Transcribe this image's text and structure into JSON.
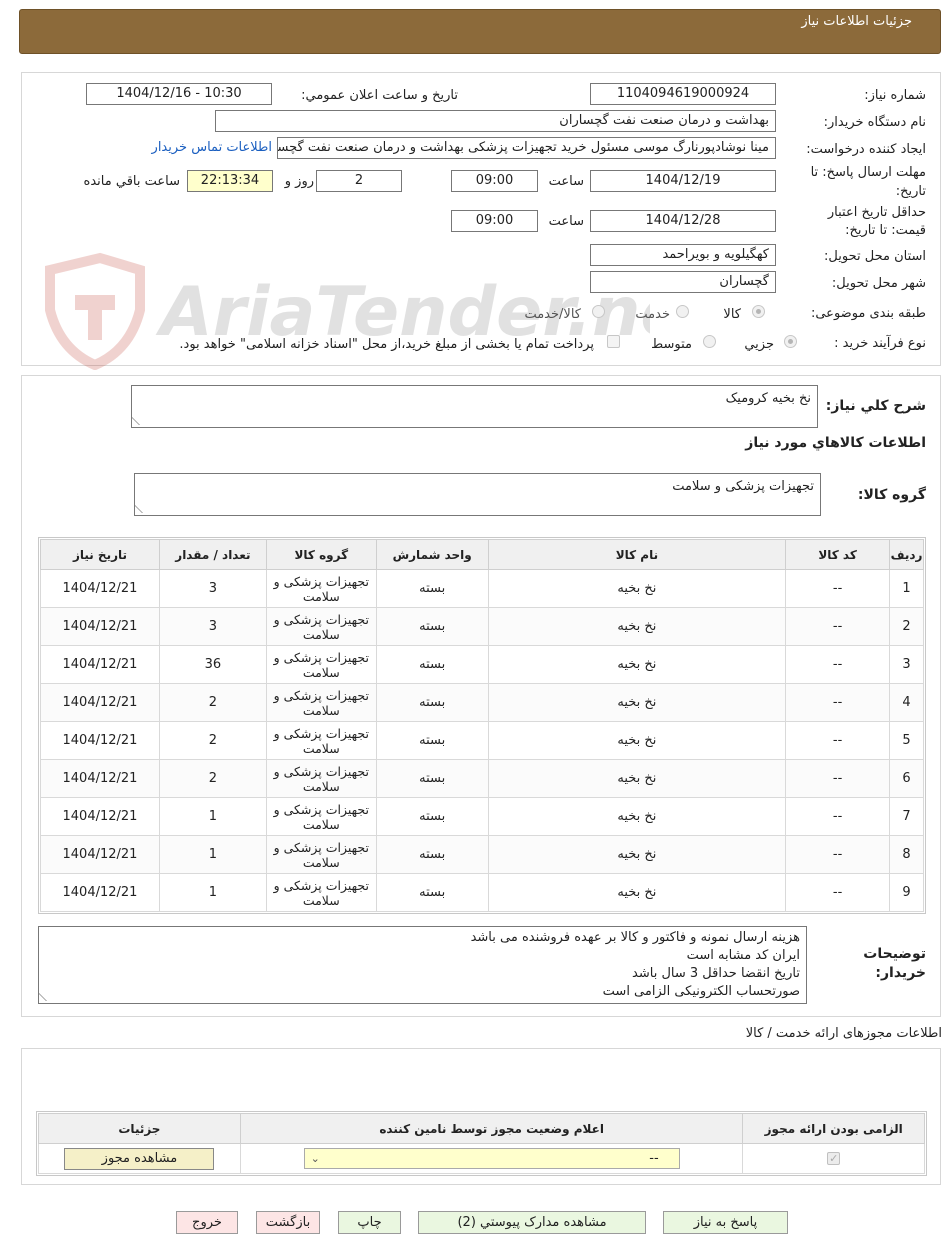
{
  "page": {
    "title": "جزئیات اطلاعات نیاز"
  },
  "form": {
    "need_number_label": "شماره نیاز:",
    "need_number": "1104094619000924",
    "announce_label": "تاریخ و ساعت اعلان عمومي:",
    "announce_value": "1404/12/16 - 10:30",
    "buyer_label": "نام دستگاه خریدار:",
    "buyer_value": "بهداشت و درمان صنعت نفت گچساران",
    "creator_label": "ایجاد کننده درخواست:",
    "creator_value": "مینا نوشادپورنارگ موسی مسئول خرید تجهیزات پزشکی  بهداشت و درمان صنعت نفت گچساران",
    "contact_link": "اطلاعات تماس خریدار",
    "deadline_label_1": "مهلت ارسال پاسخ: تا",
    "deadline_label_2": "تاریخ:",
    "deadline_date": "1404/12/19",
    "hour_label": "ساعت",
    "deadline_time": "09:00",
    "days_value": "2",
    "days_label": "روز و",
    "remaining_time": "22:13:34",
    "remaining_label": "ساعت باقي مانده",
    "validity_label_1": "حداقل تاریخ اعتبار",
    "validity_label_2": "قیمت: تا تاریخ:",
    "validity_date": "1404/12/28",
    "validity_time": "09:00",
    "province_label": "استان محل تحویل:",
    "province_value": "کهگیلویه و بویراحمد",
    "city_label": "شهر محل تحویل:",
    "city_value": "گچساران",
    "category_label": "طبقه بندی موضوعی:",
    "category_options": [
      "کالا",
      "خدمت",
      "کالا/خدمت"
    ],
    "process_label": "نوع فرآیند خرید :",
    "process_options": [
      "جزیي",
      "متوسط"
    ],
    "payment_note": "پرداخت تمام یا بخشی از مبلغ خرید،از محل \"اسناد خزانه اسلامی\" خواهد بود."
  },
  "description": {
    "label": "شرح کلي نیاز:",
    "value": "نخ بخیه کرومیک",
    "goods_info_title": "اطلاعات کالاهاي مورد نیاز",
    "group_label": "گروه کالا:",
    "group_value": "تجهیزات پزشکی و سلامت"
  },
  "items_table": {
    "headers": [
      "ردیف",
      "کد کالا",
      "نام کالا",
      "واحد شمارش",
      "گروه کالا",
      "تعداد / مقدار",
      "تاریخ نیاز"
    ],
    "rows": [
      {
        "row": "1",
        "code": "--",
        "name": "نخ بخیه",
        "unit": "بسته",
        "group": "تجهیزات پزشکی و سلامت",
        "qty": "3",
        "date": "1404/12/21"
      },
      {
        "row": "2",
        "code": "--",
        "name": "نخ بخیه",
        "unit": "بسته",
        "group": "تجهیزات پزشکی و سلامت",
        "qty": "3",
        "date": "1404/12/21"
      },
      {
        "row": "3",
        "code": "--",
        "name": "نخ بخیه",
        "unit": "بسته",
        "group": "تجهیزات پزشکی و سلامت",
        "qty": "36",
        "date": "1404/12/21"
      },
      {
        "row": "4",
        "code": "--",
        "name": "نخ بخیه",
        "unit": "بسته",
        "group": "تجهیزات پزشکی و سلامت",
        "qty": "2",
        "date": "1404/12/21"
      },
      {
        "row": "5",
        "code": "--",
        "name": "نخ بخیه",
        "unit": "بسته",
        "group": "تجهیزات پزشکی و سلامت",
        "qty": "2",
        "date": "1404/12/21"
      },
      {
        "row": "6",
        "code": "--",
        "name": "نخ بخیه",
        "unit": "بسته",
        "group": "تجهیزات پزشکی و سلامت",
        "qty": "2",
        "date": "1404/12/21"
      },
      {
        "row": "7",
        "code": "--",
        "name": "نخ بخیه",
        "unit": "بسته",
        "group": "تجهیزات پزشکی و سلامت",
        "qty": "1",
        "date": "1404/12/21"
      },
      {
        "row": "8",
        "code": "--",
        "name": "نخ بخیه",
        "unit": "بسته",
        "group": "تجهیزات پزشکی و سلامت",
        "qty": "1",
        "date": "1404/12/21"
      },
      {
        "row": "9",
        "code": "--",
        "name": "نخ بخیه",
        "unit": "بسته",
        "group": "تجهیزات پزشکی و سلامت",
        "qty": "1",
        "date": "1404/12/21"
      }
    ]
  },
  "buyer_notes": {
    "label_1": "توضیحات",
    "label_2": "خریدار:",
    "lines": [
      "هزینه ارسال نمونه و فاکتور و کالا بر عهده فروشنده می باشد",
      "ایران کد مشابه است",
      "تاریخ انقضا حداقل 3 سال باشد",
      "صورتحساب الکترونیکی الزامی است"
    ]
  },
  "permits": {
    "title": "اطلاعات مجوزهای ارائه خدمت / کالا",
    "headers": [
      "الزامی بودن ارائه مجوز",
      "اعلام وضعیت مجوز توسط نامین کننده",
      "جزئیات"
    ],
    "select_value": "--",
    "view_button": "مشاهده مجوز"
  },
  "actions": {
    "reply": "پاسخ به نیاز",
    "attachments": "مشاهده مدارک پیوستي (2)",
    "print": "چاپ",
    "back": "بازگشت",
    "exit": "خروج"
  },
  "watermark": {
    "brand": "AriaTender.neT"
  },
  "colors": {
    "header": "#8c6a3a",
    "link": "#1b5fc0",
    "green_button": "#eaf7e0",
    "red_button": "#fde5e5",
    "highlight": "#ffffcc"
  }
}
